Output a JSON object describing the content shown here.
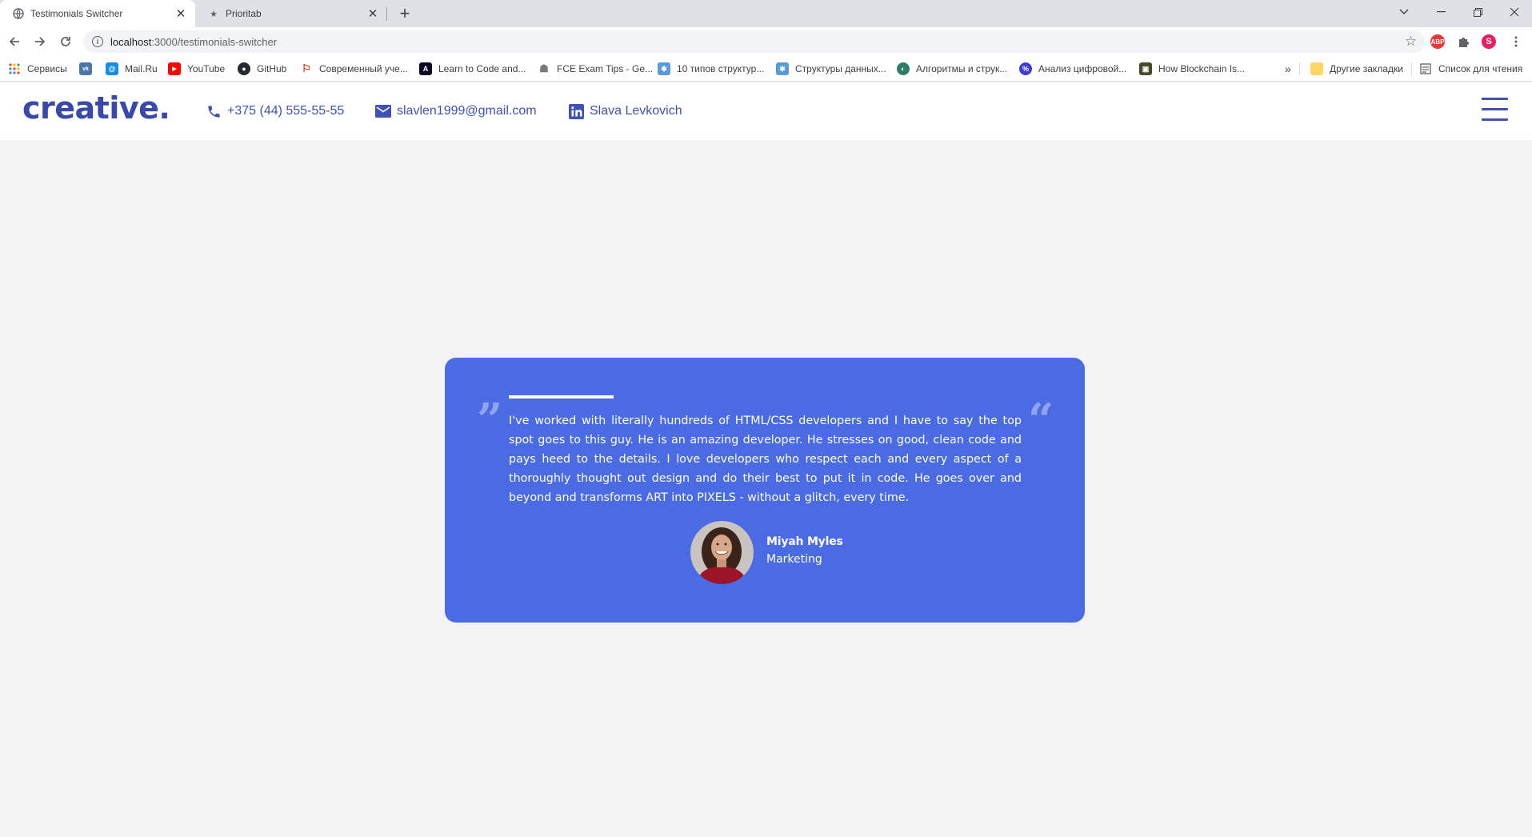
{
  "browser": {
    "tabs": [
      {
        "title": "Testimonials Switcher",
        "active": true,
        "icon": "globe-icon"
      },
      {
        "title": "Prioritab",
        "active": false,
        "icon": "star-icon"
      }
    ],
    "url_host": "localhost",
    "url_path": ":3000/testimonials-switcher",
    "profile_initial": "S",
    "abp_label": "ABP",
    "bookmarks": [
      {
        "label": "Сервисы",
        "icon": "apps-grid-icon",
        "color": "#e8453c"
      },
      {
        "label": "",
        "icon": "vk-icon",
        "color": "#4a76a8",
        "glyph": "vk"
      },
      {
        "label": "Mail.Ru",
        "icon": "mailru-icon",
        "color": "#168de2",
        "glyph": "@"
      },
      {
        "label": "YouTube",
        "icon": "youtube-icon",
        "color": "#ff0000",
        "glyph": "▶"
      },
      {
        "label": "GitHub",
        "icon": "github-icon",
        "color": "#24292e",
        "glyph": "●"
      },
      {
        "label": "Современный уче...",
        "icon": "learnjs-icon",
        "color": "#dd2c00",
        "glyph": "⚐"
      },
      {
        "label": "Learn to Code and...",
        "icon": "freecodecamp-icon",
        "color": "#0a0a23",
        "glyph": "A"
      },
      {
        "label": "FCE Exam Tips - Ge...",
        "icon": "fce-icon",
        "color": "#7a7a7a",
        "glyph": "☗"
      },
      {
        "label": "10 типов структур...",
        "icon": "habr-icon",
        "color": "#5a9bd5",
        "glyph": "✱"
      },
      {
        "label": "Структуры данных...",
        "icon": "habr-icon",
        "color": "#5a9bd5",
        "glyph": "✱"
      },
      {
        "label": "Алгоритмы и струк...",
        "icon": "algo-icon",
        "color": "#2e7d6b",
        "glyph": "◐"
      },
      {
        "label": "Анализ цифровой...",
        "icon": "analysis-icon",
        "color": "#3d3dd6",
        "glyph": "%"
      },
      {
        "label": "How Blockchain Is...",
        "icon": "blockchain-icon",
        "color": "#4a4a2a",
        "glyph": "▣"
      }
    ],
    "bookmarks_overflow": "»",
    "other_bookmarks": "Другие закладки",
    "reading_list": "Список для чтения"
  },
  "header": {
    "logo": "creative.",
    "phone": "+375 (44) 555-55-55",
    "email": "slavlen1999@gmail.com",
    "linkedin": "Slava Levkovich"
  },
  "testimonial": {
    "text": "I've worked with literally hundreds of HTML/CSS developers and I have to say the top spot goes to this guy. He is an amazing developer. He stresses on good, clean code and pays heed to the details. I love developers who respect each and every aspect of a thoroughly thought out design and do their best to put it in code. He goes over and beyond and transforms ART into PIXELS - without a glitch, every time.",
    "name": "Miyah Myles",
    "role": "Marketing",
    "open_quote": "”",
    "close_quote": "“"
  },
  "colors": {
    "brand": "#3f51b5",
    "card": "#4a6be3",
    "page_bg": "#f3f3f3"
  }
}
